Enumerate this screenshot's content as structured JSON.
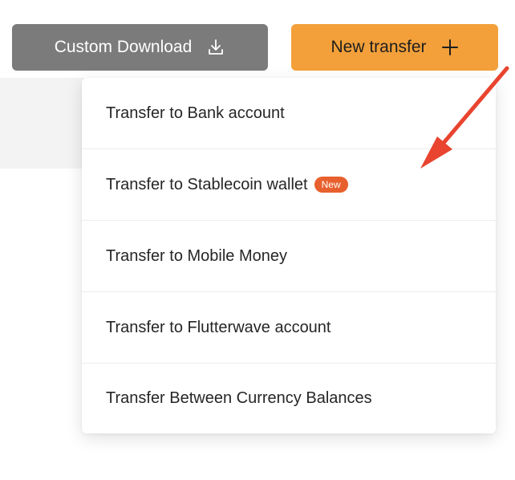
{
  "toolbar": {
    "download_label": "Custom Download",
    "download_icon": "download-icon",
    "new_transfer_label": "New transfer",
    "new_transfer_icon": "plus-icon"
  },
  "menu": {
    "items": [
      {
        "label": "Transfer to Bank account"
      },
      {
        "label": "Transfer to Stablecoin wallet",
        "badge": "New"
      },
      {
        "label": "Transfer to Mobile Money"
      },
      {
        "label": "Transfer to Flutterwave account"
      },
      {
        "label": "Transfer Between Currency Balances"
      }
    ]
  },
  "colors": {
    "download_button_bg": "#7b7b7b",
    "new_transfer_button_bg": "#f3a03a",
    "badge_bg": "#e8602d",
    "annotation_arrow": "#e8442f"
  },
  "annotation": {
    "type": "arrow",
    "icon": "arrow-icon"
  }
}
